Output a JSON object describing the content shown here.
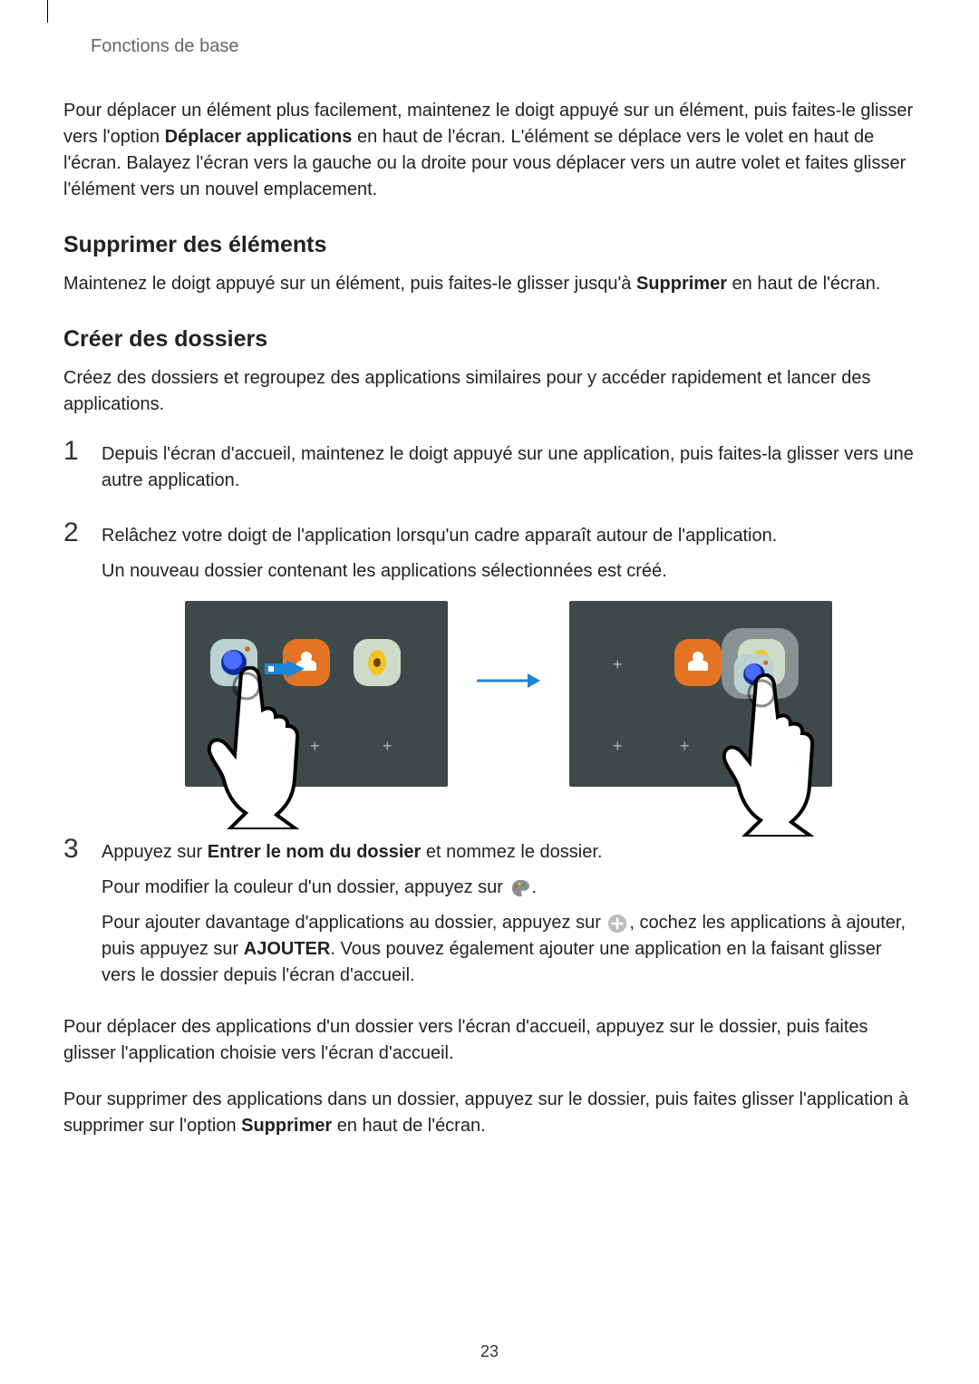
{
  "breadcrumb": "Fonctions de base",
  "intro_para_pre": "Pour déplacer un élément plus facilement, maintenez le doigt appuyé sur un élément, puis faites-le glisser vers l'option ",
  "intro_para_bold": "Déplacer applications",
  "intro_para_post": " en haut de l'écran. L'élément se déplace vers le volet en haut de l'écran. Balayez l'écran vers la gauche ou la droite pour vous déplacer vers un autre volet et faites glisser l'élément vers un nouvel emplacement.",
  "h_delete": "Supprimer des éléments",
  "delete_para_pre": "Maintenez le doigt appuyé sur un élément, puis faites-le glisser jusqu'à ",
  "delete_para_bold": "Supprimer",
  "delete_para_post": " en haut de l'écran.",
  "h_folders": "Créer des dossiers",
  "folders_intro": "Créez des dossiers et regroupez des applications similaires pour y accéder rapidement et lancer des applications.",
  "steps": {
    "n1": "1",
    "s1": "Depuis l'écran d'accueil, maintenez le doigt appuyé sur une application, puis faites-la glisser vers une autre application.",
    "n2": "2",
    "s2a": "Relâchez votre doigt de l'application lorsqu'un cadre apparaît autour de l'application.",
    "s2b": "Un nouveau dossier contenant les applications sélectionnées est créé.",
    "n3": "3",
    "s3a_pre": "Appuyez sur ",
    "s3a_bold": "Entrer le nom du dossier",
    "s3a_post": " et nommez le dossier.",
    "s3b": "Pour modifier la couleur d'un dossier, appuyez sur ",
    "s3c_pre": "Pour ajouter davantage d'applications au dossier, appuyez sur ",
    "s3c_mid": ", cochez les applications à ajouter, puis appuyez sur ",
    "s3c_bold": "AJOUTER",
    "s3c_post": ". Vous pouvez également ajouter une application en la faisant glisser vers le dossier depuis l'écran d'accueil."
  },
  "move_out_para": "Pour déplacer des applications d'un dossier vers l'écran d'accueil, appuyez sur le dossier, puis faites glisser l'application choisie vers l'écran d'accueil.",
  "remove_para_pre": "Pour supprimer des applications dans un dossier, appuyez sur le dossier, puis faites glisser l'application à supprimer sur l'option ",
  "remove_para_bold": "Supprimer",
  "remove_para_post": " en haut de l'écran.",
  "page_number": "23"
}
